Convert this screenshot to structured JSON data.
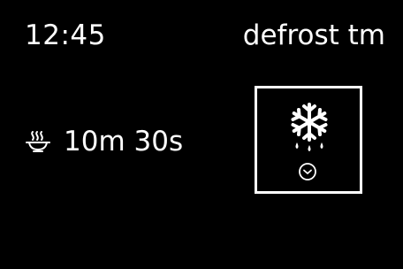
{
  "status_bar": {
    "time": "12:45",
    "mode_title": "defrost tm"
  },
  "cook_info": {
    "icon": "steam-dish-icon",
    "duration": "10m 30s"
  },
  "program_tile": {
    "icon": "snowflake-defrost-icon",
    "sub_icon": "timer-icon"
  },
  "colors": {
    "background": "#000000",
    "foreground": "#ffffff"
  }
}
